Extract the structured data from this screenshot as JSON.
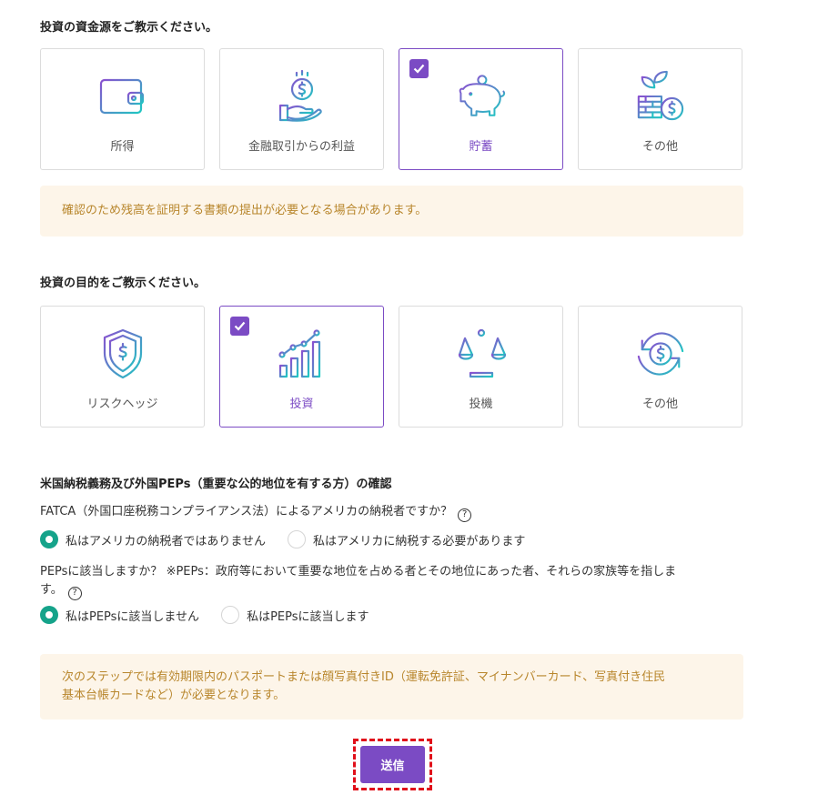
{
  "source_section": {
    "title": "投資の資金源をご教示ください。",
    "cards": [
      {
        "label": "所得",
        "icon": "wallet-icon",
        "selected": false
      },
      {
        "label": "金融取引からの利益",
        "icon": "hand-coin-icon",
        "selected": false
      },
      {
        "label": "貯蓄",
        "icon": "piggy-bank-icon",
        "selected": true
      },
      {
        "label": "その他",
        "icon": "plant-coins-icon",
        "selected": false
      }
    ],
    "notice": "確認のため残高を証明する書類の提出が必要となる場合があります。"
  },
  "purpose_section": {
    "title": "投資の目的をご教示ください。",
    "cards": [
      {
        "label": "リスクヘッジ",
        "icon": "shield-dollar-icon",
        "selected": false
      },
      {
        "label": "投資",
        "icon": "growth-chart-icon",
        "selected": true
      },
      {
        "label": "投機",
        "icon": "scale-icon",
        "selected": false
      },
      {
        "label": "その他",
        "icon": "refresh-dollar-icon",
        "selected": false
      }
    ]
  },
  "compliance_section": {
    "title": "米国納税義務及び外国PEPs（重要な公的地位を有する方）の確認",
    "fatca_question": "FATCA（外国口座税務コンプライアンス法）によるアメリカの納税者ですか？",
    "fatca_options": [
      "私はアメリカの納税者ではありません",
      "私はアメリカに納税する必要があります"
    ],
    "fatca_selected": 0,
    "peps_question_line1": "PEPsに該当しますか？ ※PEPs：政府等において重要な地位を占める者とその地位にあった者、それらの家族等を指しま",
    "peps_question_line2": "す。",
    "peps_options": [
      "私はPEPsに該当しません",
      "私はPEPsに該当します"
    ],
    "peps_selected": 0,
    "help_symbol": "?",
    "notice_line1": "次のステップでは有効期限内のパスポートまたは顔写真付きID（運転免許証、マイナンバーカード、写真付き住民",
    "notice_line2": "基本台帳カードなど）が必要となります。"
  },
  "submit": {
    "label": "送信"
  },
  "colors": {
    "accent": "#7b4bc4",
    "radio": "#15a38a",
    "notice_bg": "#fdf5e9",
    "notice_text": "#b8862c",
    "highlight": "#e0101a"
  }
}
